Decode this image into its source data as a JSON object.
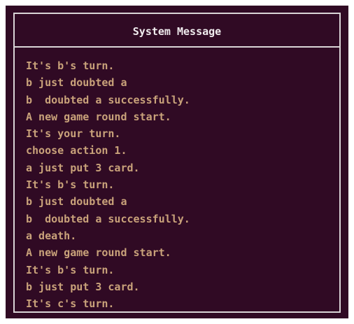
{
  "panel": {
    "title": "System Message"
  },
  "messages": [
    "It's b's turn.",
    "b just doubted a",
    "b  doubted a successfully.",
    "A new game round start.",
    "It's your turn.",
    "choose action 1.",
    "a just put 3 card.",
    "It's b's turn.",
    "b just doubted a",
    "b  doubted a successfully.",
    "a death.",
    "A new game round start.",
    "It's b's turn.",
    "b just put 3 card.",
    "It's c's turn."
  ],
  "colors": {
    "background": "#300a24",
    "border": "#d9d4d6",
    "title_text": "#f0ecee",
    "message_text": "#c9a27a"
  }
}
